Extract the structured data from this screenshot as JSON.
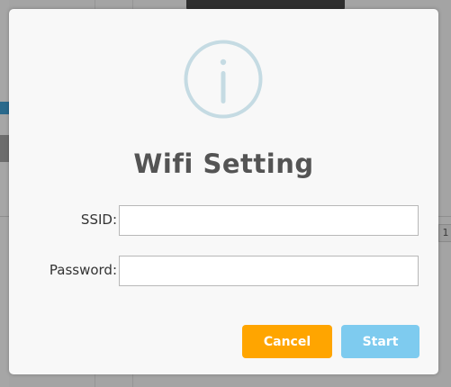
{
  "dialog": {
    "title": "Wifi Setting",
    "icon": "info-circle-icon",
    "fields": {
      "ssid": {
        "label": "SSID:",
        "value": "",
        "placeholder": ""
      },
      "password": {
        "label": "Password:",
        "value": "",
        "placeholder": ""
      }
    },
    "buttons": {
      "cancel_label": "Cancel",
      "start_label": "Start"
    }
  },
  "background": {
    "page_number": "1"
  },
  "colors": {
    "cancel": "#ffa500",
    "start": "#7ecbef",
    "icon": "#c5dbe3",
    "title": "#545454"
  }
}
